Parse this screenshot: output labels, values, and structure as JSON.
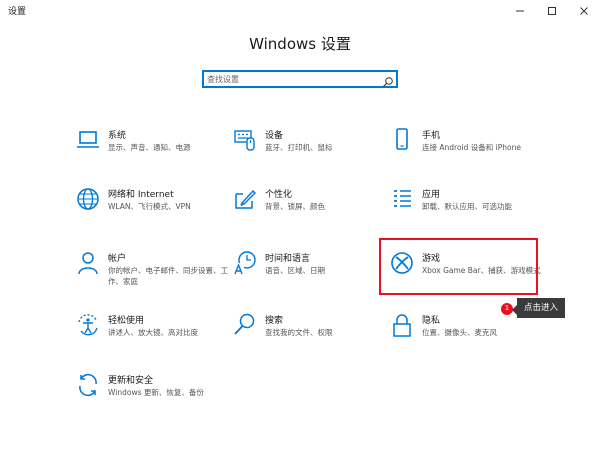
{
  "window": {
    "title": "设置"
  },
  "page": {
    "title": "Windows 设置"
  },
  "search": {
    "placeholder": "查找设置"
  },
  "accent": "#0078d7",
  "tiles": [
    {
      "name": "系统",
      "desc": "显示、声音、通知、电源",
      "icon": "laptop-icon"
    },
    {
      "name": "设备",
      "desc": "蓝牙、打印机、鼠标",
      "icon": "keyboard-icon"
    },
    {
      "name": "手机",
      "desc": "连接 Android 设备和 iPhone",
      "icon": "phone-icon"
    },
    {
      "name": "网络和 Internet",
      "desc": "WLAN、飞行模式、VPN",
      "icon": "globe-icon"
    },
    {
      "name": "个性化",
      "desc": "背景、锁屏、颜色",
      "icon": "paint-icon"
    },
    {
      "name": "应用",
      "desc": "卸载、默认应用、可选功能",
      "icon": "apps-list-icon"
    },
    {
      "name": "帐户",
      "desc": "你的帐户、电子邮件、同步设置、工作、家庭",
      "icon": "person-icon"
    },
    {
      "name": "时间和语言",
      "desc": "语音、区域、日期",
      "icon": "time-language-icon"
    },
    {
      "name": "游戏",
      "desc": "Xbox Game Bar、捕获、游戏模式",
      "icon": "xbox-icon"
    },
    {
      "name": "轻松使用",
      "desc": "讲述人、放大镜、高对比度",
      "icon": "ease-of-access-icon"
    },
    {
      "name": "搜索",
      "desc": "查找我的文件、权限",
      "icon": "search-icon"
    },
    {
      "name": "隐私",
      "desc": "位置、摄像头、麦克风",
      "icon": "lock-icon"
    },
    {
      "name": "更新和安全",
      "desc": "Windows 更新、恢复、备份",
      "icon": "update-icon"
    }
  ],
  "annotation": {
    "step": "1",
    "text": "点击进入",
    "highlight_color": "#e81123"
  }
}
